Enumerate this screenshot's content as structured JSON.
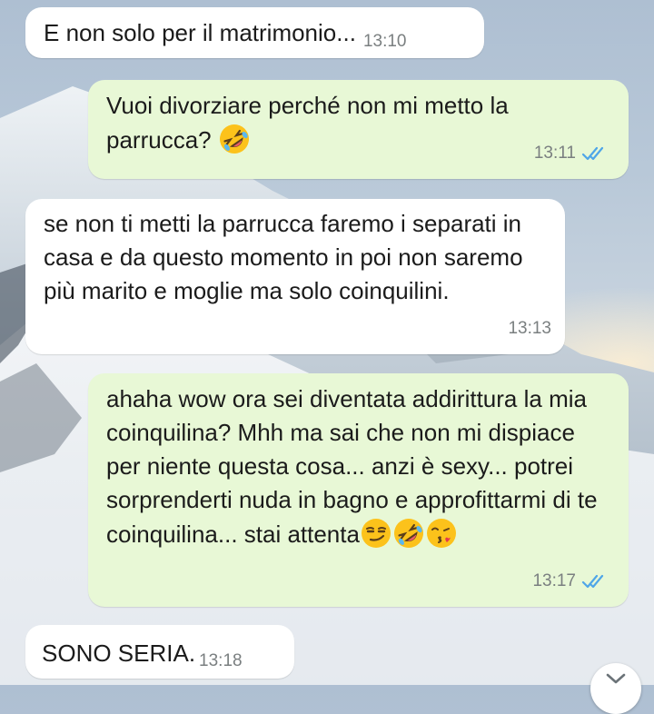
{
  "chat": {
    "messages": [
      {
        "direction": "incoming",
        "text": "E non solo per il matrimonio...",
        "time": "13:10"
      },
      {
        "direction": "outgoing",
        "text": "Vuoi divorziare perché non mi metto la parrucca?",
        "emojis": [
          "rolling-on-floor-laughing"
        ],
        "time": "13:11",
        "status": "read"
      },
      {
        "direction": "incoming",
        "text": "se non ti metti la parrucca faremo i separati in casa e da questo momento in poi non saremo più marito e moglie ma solo coinquilini.",
        "time": "13:13"
      },
      {
        "direction": "outgoing",
        "text": "ahaha wow ora sei diventata addirittura la mia coinquilina? Mhh ma sai che non mi dispiace per niente questa cosa... anzi è sexy... potrei sorprenderti nuda in bagno e approfittarmi di te coinquilina... stai attenta",
        "emojis": [
          "smirking-face",
          "rolling-on-floor-laughing",
          "face-blowing-a-kiss"
        ],
        "time": "13:17",
        "status": "read"
      },
      {
        "direction": "incoming",
        "text": "SONO SERIA.",
        "time": "13:18"
      }
    ]
  },
  "colors": {
    "incoming_bubble": "#ffffff",
    "outgoing_bubble": "#e8f8d6",
    "read_ticks": "#4fa6e8",
    "timestamp": "#7a7f80"
  },
  "icons": {
    "read_receipt": "double-check-icon",
    "scroll_down": "chevron-down-icon"
  }
}
